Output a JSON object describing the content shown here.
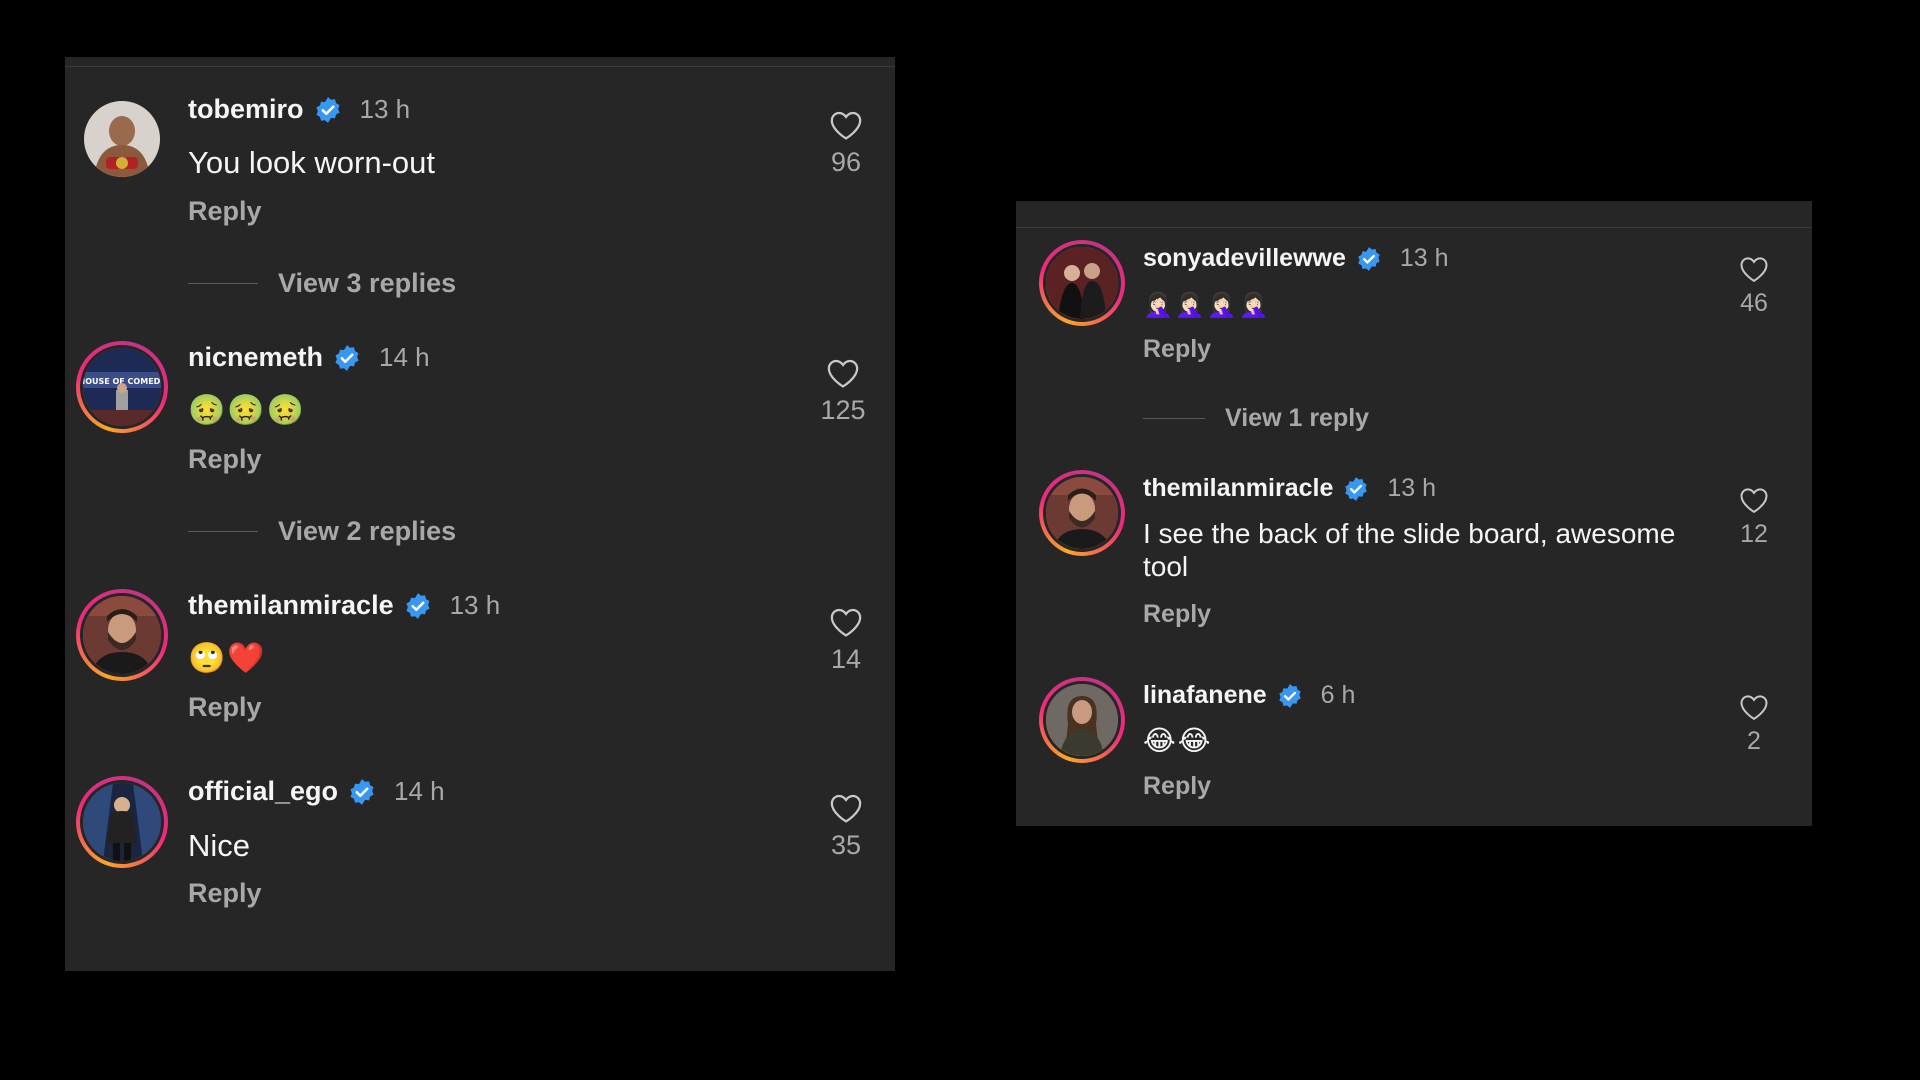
{
  "left_panel": {
    "comments": [
      {
        "username": "tobemiro",
        "time": "13 h",
        "text": "You look worn-out",
        "reply": "Reply",
        "likes": "96",
        "view_replies": "View 3 replies",
        "avatar": "avatar-wrestler-champion"
      },
      {
        "username": "nicnemeth",
        "time": "14 h",
        "text": "🤢🤢🤢",
        "reply": "Reply",
        "likes": "125",
        "view_replies": "View 2 replies",
        "avatar": "avatar-house-of-comedy"
      },
      {
        "username": "themilanmiracle",
        "time": "13 h",
        "text": "🙄❤️",
        "reply": "Reply",
        "likes": "14",
        "avatar": "avatar-bearded-man"
      },
      {
        "username": "official_ego",
        "time": "14 h",
        "text": "Nice",
        "reply": "Reply",
        "likes": "35",
        "avatar": "avatar-wrestler-entrance"
      }
    ]
  },
  "right_panel": {
    "comments": [
      {
        "username": "sonyadevillewwe",
        "time": "13 h",
        "text": "🤦🏻‍♀️🤦🏻‍♀️🤦🏻‍♀️🤦🏻‍♀️",
        "reply": "Reply",
        "likes": "46",
        "view_replies": "View 1 reply",
        "avatar": "avatar-couple"
      },
      {
        "username": "themilanmiracle",
        "time": "13 h",
        "text_line1": "I see the back of the slide board, awesome",
        "text_line2": "tool",
        "reply": "Reply",
        "likes": "12",
        "avatar": "avatar-bearded-man"
      },
      {
        "username": "linafanene",
        "time": "6 h",
        "text": "😂😂",
        "reply": "Reply",
        "likes": "2",
        "avatar": "avatar-woman"
      }
    ]
  },
  "colors": {
    "background": "#000000",
    "panel": "#262626",
    "verified": "#3897f0",
    "muted": "#a8a8a8",
    "text": "#f5f5f5"
  }
}
